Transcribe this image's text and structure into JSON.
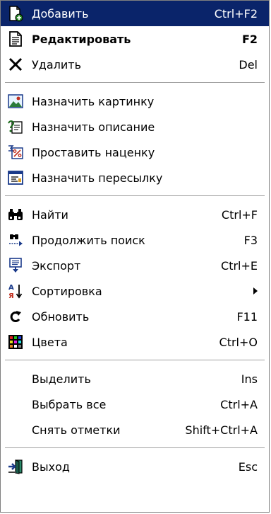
{
  "menu": {
    "groups": [
      [
        {
          "icon": "add-document-icon",
          "label": "Добавить",
          "shortcut": "Ctrl+F2",
          "selected": true
        },
        {
          "icon": "edit-document-icon",
          "label": "Редактировать",
          "shortcut": "F2",
          "bold": true
        },
        {
          "icon": "delete-x-icon",
          "label": "Удалить",
          "shortcut": "Del"
        }
      ],
      [
        {
          "icon": "picture-icon",
          "label": "Назначить картинку",
          "shortcut": ""
        },
        {
          "icon": "description-icon",
          "label": "Назначить описание",
          "shortcut": ""
        },
        {
          "icon": "markup-percent-icon",
          "label": "Проставить наценку",
          "shortcut": ""
        },
        {
          "icon": "shipping-form-icon",
          "label": "Назначить пересылку",
          "shortcut": ""
        }
      ],
      [
        {
          "icon": "binoculars-icon",
          "label": "Найти",
          "shortcut": "Ctrl+F"
        },
        {
          "icon": "find-next-icon",
          "label": "Продолжить поиск",
          "shortcut": "F3"
        },
        {
          "icon": "export-icon",
          "label": "Экспорт",
          "shortcut": "Ctrl+E"
        },
        {
          "icon": "sort-az-icon",
          "label": "Сортировка",
          "shortcut": "",
          "submenu": true
        },
        {
          "icon": "refresh-icon",
          "label": "Обновить",
          "shortcut": "F11"
        },
        {
          "icon": "colors-grid-icon",
          "label": "Цвета",
          "shortcut": "Ctrl+O"
        }
      ],
      [
        {
          "icon": "",
          "label": "Выделить",
          "shortcut": "Ins"
        },
        {
          "icon": "",
          "label": "Выбрать все",
          "shortcut": "Ctrl+A"
        },
        {
          "icon": "",
          "label": "Снять отметки",
          "shortcut": "Shift+Ctrl+A"
        }
      ],
      [
        {
          "icon": "exit-door-icon",
          "label": "Выход",
          "shortcut": "Esc"
        }
      ]
    ]
  },
  "colors": {
    "selection": "#0a246a",
    "separator": "#a0a0a0"
  }
}
